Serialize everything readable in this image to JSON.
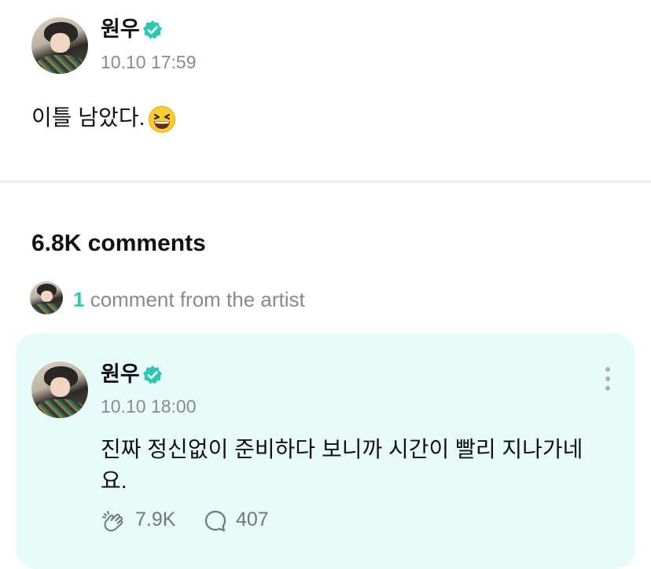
{
  "post": {
    "author": "원우",
    "timestamp": "10.10 17:59",
    "text": "이틀 남았다.",
    "emoji": "grinning-squinting-face"
  },
  "comments": {
    "count_label": "6.8K comments",
    "artist_count": "1",
    "artist_label": " comment from the artist"
  },
  "artist_comment": {
    "author": "원우",
    "timestamp": "10.10 18:00",
    "text": "진짜 정신없이 준비하다 보니까 시간이 빨리 지나가네요.",
    "likes": "7.9K",
    "replies": "407"
  },
  "colors": {
    "accent": "#2bc8b7",
    "card_bg": "#e9fbf8",
    "muted": "#8a8a8a"
  }
}
